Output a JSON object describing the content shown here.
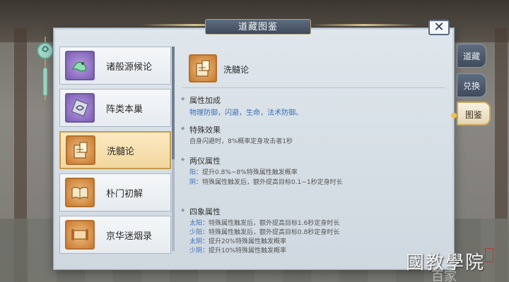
{
  "window": {
    "title": "道藏图鉴",
    "close_label": "✕"
  },
  "tabs": [
    {
      "label": "道藏",
      "active": false
    },
    {
      "label": "兑换",
      "active": false
    },
    {
      "label": "图鉴",
      "active": true
    }
  ],
  "list": {
    "items": [
      {
        "label": "诸般源候论",
        "icon": "jade-dragon-icon",
        "selected": false
      },
      {
        "label": "阵类本巢",
        "icon": "rune-token-icon",
        "selected": false
      },
      {
        "label": "洗髓论",
        "icon": "scroll-book-icon",
        "selected": true
      },
      {
        "label": "朴门初解",
        "icon": "open-book-icon",
        "selected": false
      },
      {
        "label": "京华迷烟录",
        "icon": "scroll-icon",
        "selected": false
      }
    ]
  },
  "detail": {
    "name": "洗髓论",
    "icon": "scroll-book-icon",
    "sections": {
      "attr_bonus": {
        "title": "属性加成",
        "value": "物理防御，闪避，生命，法术防御。"
      },
      "special": {
        "title": "特殊效果",
        "value": "自身闪避时，8%概率定身攻击者1秒"
      },
      "liangyi": {
        "title": "两仪属性",
        "lines": [
          {
            "tag": "阳：",
            "text": "提升0.8%~8%特殊属性触发概率"
          },
          {
            "tag": "阴：",
            "text": "特殊属性触发后，额外提高目标0.1~1秒定身时长"
          }
        ]
      },
      "sixiang": {
        "title": "四象属性",
        "lines": [
          {
            "tag": "太阳：",
            "text": "特殊属性触发后，额外提高目标1.6秒定身时长"
          },
          {
            "tag": "少阳：",
            "text": "特殊属性触发后，额外提高目标0.8秒定身时长"
          },
          {
            "tag": "太阴：",
            "text": "提升20%特殊属性触发概率"
          },
          {
            "tag": "少阴：",
            "text": "提升10%特殊属性触发概率"
          }
        ]
      }
    }
  },
  "watermark": {
    "text": "國教學院",
    "sub": "百家"
  }
}
